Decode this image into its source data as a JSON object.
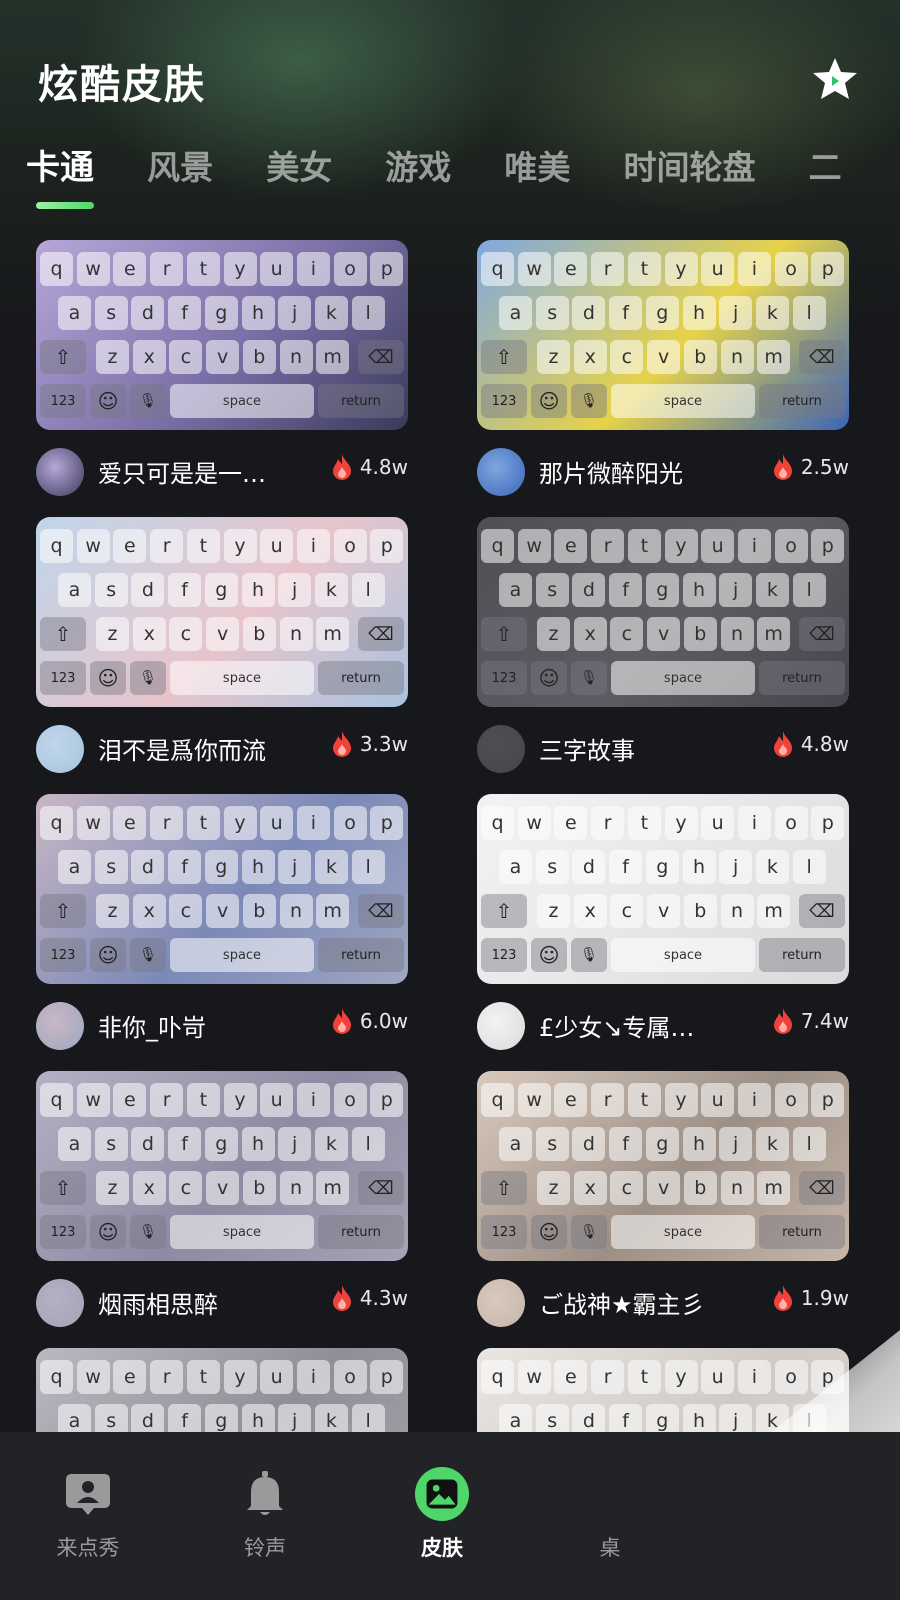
{
  "header": {
    "title": "炫酷皮肤",
    "star_icon": "sparkle-star-icon"
  },
  "tabs": [
    {
      "label": "卡通",
      "active": true
    },
    {
      "label": "风景",
      "active": false
    },
    {
      "label": "美女",
      "active": false
    },
    {
      "label": "游戏",
      "active": false
    },
    {
      "label": "唯美",
      "active": false
    },
    {
      "label": "时间轮盘",
      "active": false
    },
    {
      "label": "二",
      "active": false
    }
  ],
  "keyboard": {
    "row1": [
      "q",
      "w",
      "e",
      "r",
      "t",
      "y",
      "u",
      "i",
      "o",
      "p"
    ],
    "row2": [
      "a",
      "s",
      "d",
      "f",
      "g",
      "h",
      "j",
      "k",
      "l"
    ],
    "row3": [
      "z",
      "x",
      "c",
      "v",
      "b",
      "n",
      "m"
    ],
    "num_key": "123",
    "space_key": "space",
    "return_key": "return"
  },
  "skins": [
    {
      "author": "爱只可是是一…",
      "hot": "4.8w",
      "bg": [
        "#b7a7d8",
        "#7a6fa6",
        "#3a3a5c"
      ]
    },
    {
      "author": "那片微醉阳光",
      "hot": "2.5w",
      "bg": [
        "#7fa8e0",
        "#e6d24a",
        "#3b65b8"
      ]
    },
    {
      "author": "泪不是爲你而流",
      "hot": "3.3w",
      "bg": [
        "#bfd6ea",
        "#e7c4cc",
        "#a9c3df"
      ]
    },
    {
      "author": "三字故事",
      "hot": "4.8w",
      "bg": [
        "#4f4f55",
        "#5c5c62",
        "#45454b"
      ]
    },
    {
      "author": "非你_卟岢",
      "hot": "6.0w",
      "bg": [
        "#c9b7c4",
        "#7c89b8",
        "#9ea6c2"
      ]
    },
    {
      "author": "£少女↘专属…",
      "hot": "7.4w",
      "bg": [
        "#f3f3f3",
        "#e6e6e6",
        "#dadada"
      ]
    },
    {
      "author": "烟雨相思醉",
      "hot": "4.3w",
      "bg": [
        "#b3b1c4",
        "#8f8aa3",
        "#a8a2b5"
      ]
    },
    {
      "author": "ご战神★霸主彡",
      "hot": "1.9w",
      "bg": [
        "#d9c9bd",
        "#9c8f86",
        "#c7b6aa"
      ]
    },
    {
      "author": "",
      "hot": "",
      "bg": [
        "#b9b9c1",
        "#8f8f97",
        "#a4a4ac"
      ]
    },
    {
      "author": "",
      "hot": "",
      "bg": [
        "#e9e6e3",
        "#cfcac5",
        "#dcd8d4"
      ]
    }
  ],
  "nav": [
    {
      "label": "来点秀",
      "icon": "contact-card-icon",
      "active": false
    },
    {
      "label": "铃声",
      "icon": "bell-icon",
      "active": false
    },
    {
      "label": "皮肤",
      "icon": "image-skin-icon",
      "active": true
    },
    {
      "label": "桌",
      "icon": "desktop-icon",
      "active": false
    }
  ],
  "colors": {
    "accent_green": "#4fd66a",
    "hot_red": "#f0413a"
  }
}
